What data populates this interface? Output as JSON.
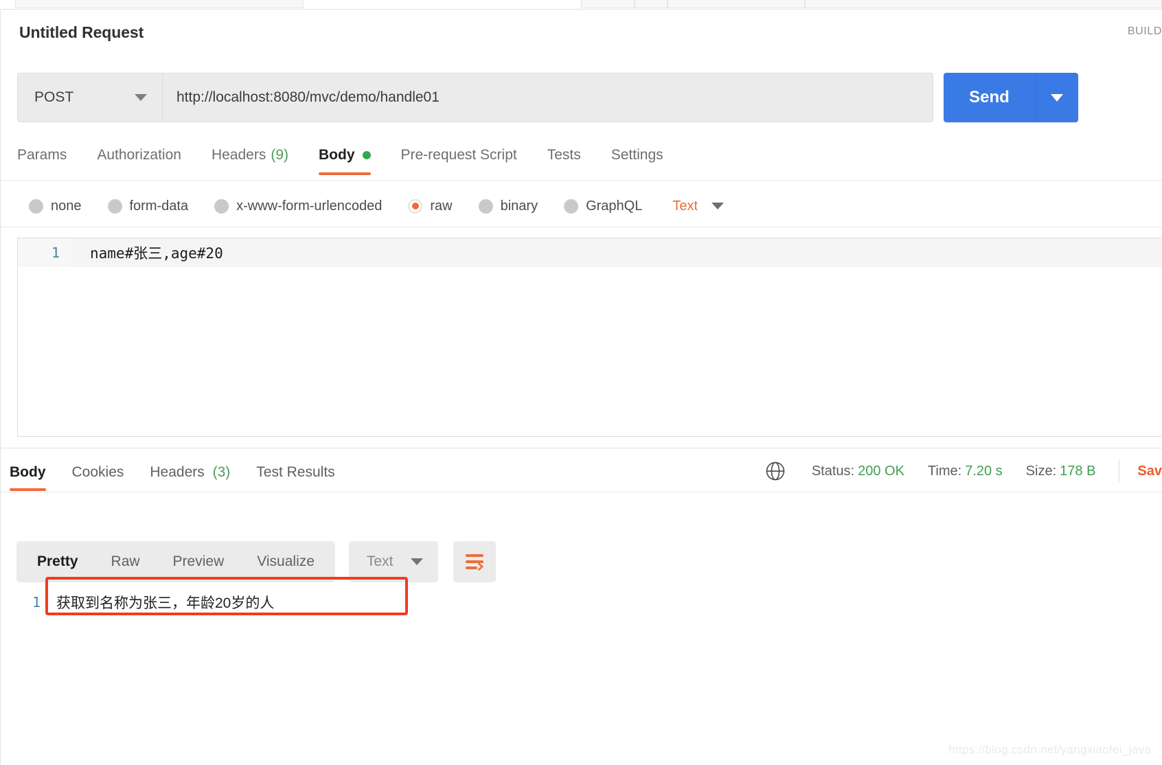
{
  "window": {
    "request_title": "Untitled Request",
    "build_label": "BUILD"
  },
  "url_bar": {
    "method": "POST",
    "url": "http://localhost:8080/mvc/demo/handle01",
    "send_label": "Send"
  },
  "request_tabs": [
    {
      "label": "Params",
      "active": false,
      "count": "",
      "dot": false
    },
    {
      "label": "Authorization",
      "active": false,
      "count": "",
      "dot": false
    },
    {
      "label": "Headers",
      "active": false,
      "count": "(9)",
      "dot": false
    },
    {
      "label": "Body",
      "active": true,
      "count": "",
      "dot": true
    },
    {
      "label": "Pre-request Script",
      "active": false,
      "count": "",
      "dot": false
    },
    {
      "label": "Tests",
      "active": false,
      "count": "",
      "dot": false
    },
    {
      "label": "Settings",
      "active": false,
      "count": "",
      "dot": false
    }
  ],
  "body_types": [
    {
      "label": "none",
      "selected": false
    },
    {
      "label": "form-data",
      "selected": false
    },
    {
      "label": "x-www-form-urlencoded",
      "selected": false
    },
    {
      "label": "raw",
      "selected": true
    },
    {
      "label": "binary",
      "selected": false
    },
    {
      "label": "GraphQL",
      "selected": false
    }
  ],
  "body_format": {
    "label": "Text"
  },
  "request_body": {
    "line_number": "1",
    "content": "name#张三,age#20"
  },
  "response_tabs": [
    {
      "label": "Body",
      "active": true,
      "count": ""
    },
    {
      "label": "Cookies",
      "active": false,
      "count": ""
    },
    {
      "label": "Headers",
      "active": false,
      "count": "(3)"
    },
    {
      "label": "Test Results",
      "active": false,
      "count": ""
    }
  ],
  "response_meta": {
    "status_label": "Status:",
    "status_value": "200 OK",
    "time_label": "Time:",
    "time_value": "7.20 s",
    "size_label": "Size:",
    "size_value": "178 B",
    "save_label": "Sav"
  },
  "response_toolbar": {
    "views": [
      {
        "label": "Pretty",
        "active": true
      },
      {
        "label": "Raw",
        "active": false
      },
      {
        "label": "Preview",
        "active": false
      },
      {
        "label": "Visualize",
        "active": false
      }
    ],
    "format_label": "Text"
  },
  "response_body": {
    "line_number": "1",
    "content": "获取到名称为张三，年龄20岁的人"
  },
  "watermark": {
    "text": "https://blog.csdn.net/yangxiaofei_java"
  },
  "colors": {
    "accent_orange": "#f26b3a",
    "send_blue": "#3a7ae4",
    "status_green": "#3f9e50",
    "highlight_red": "#f03c1e"
  }
}
